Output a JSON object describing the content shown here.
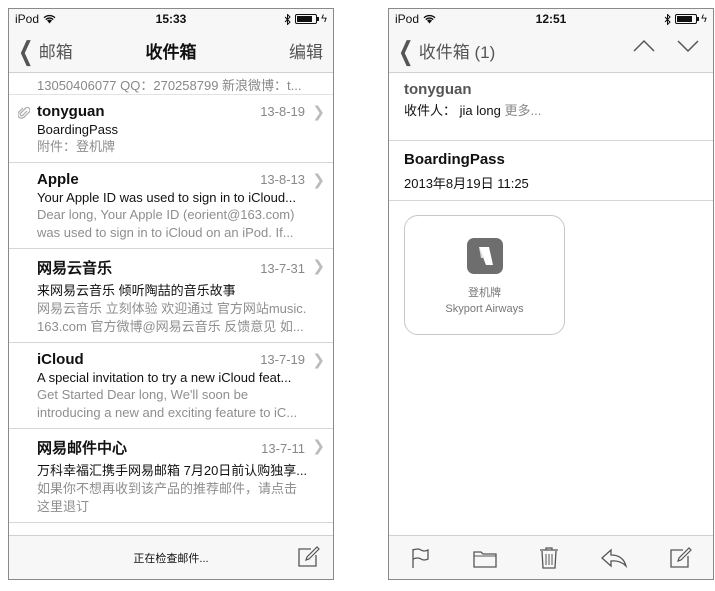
{
  "left": {
    "status": {
      "carrier": "iPod",
      "time": "15:33",
      "battery_level": 0.85
    },
    "nav": {
      "back_label": "邮箱",
      "title": "收件箱",
      "edit_label": "编辑"
    },
    "snippet_top": "13050406077 QQ：270258799 新浪微博：t...",
    "mails": [
      {
        "sender": "tonyguan",
        "date": "13-8-19",
        "subject": "BoardingPass",
        "preview": "附件：登机牌",
        "has_attachment": true
      },
      {
        "sender": "Apple",
        "date": "13-8-13",
        "subject": "Your Apple ID was used to sign in to iCloud...",
        "preview": "Dear long, Your Apple ID (eorient@163.com) was used to sign in to iCloud on an iPod. If..."
      },
      {
        "sender": "网易云音乐",
        "date": "13-7-31",
        "subject": "来网易云音乐 倾听陶喆的音乐故事",
        "preview": "网易云音乐 立刻体验 欢迎通过 官方网站music. 163.com 官方微博@网易云音乐 反馈意见 如..."
      },
      {
        "sender": "iCloud",
        "date": "13-7-19",
        "subject": "A special invitation to try a new iCloud feat...",
        "preview": "Get Started Dear long, We'll soon be introducing a new and exciting feature to iC..."
      },
      {
        "sender": "网易邮件中心",
        "date": "13-7-11",
        "subject": "万科幸福汇携手网易邮箱 7月20日前认购独享...",
        "preview": "如果你不想再收到该产品的推荐邮件，请点击 这里退订"
      }
    ],
    "bottom": {
      "status_text": "正在检查邮件..."
    }
  },
  "right": {
    "status": {
      "carrier": "iPod",
      "time": "12:51",
      "battery_level": 0.85
    },
    "nav": {
      "back_label": "收件箱 (1)"
    },
    "from": {
      "name": "tonyguan",
      "recipients_prefix": "收件人：",
      "recipients": "jia long",
      "more": "更多..."
    },
    "subject": "BoardingPass",
    "date": "2013年8月19日 11:25",
    "pass": {
      "label": "登机牌",
      "organization": "Skyport Airways"
    }
  },
  "colors": {
    "bar_bg": "#f7f7f7",
    "tint": "#555555",
    "muted": "#8e8e8e"
  }
}
